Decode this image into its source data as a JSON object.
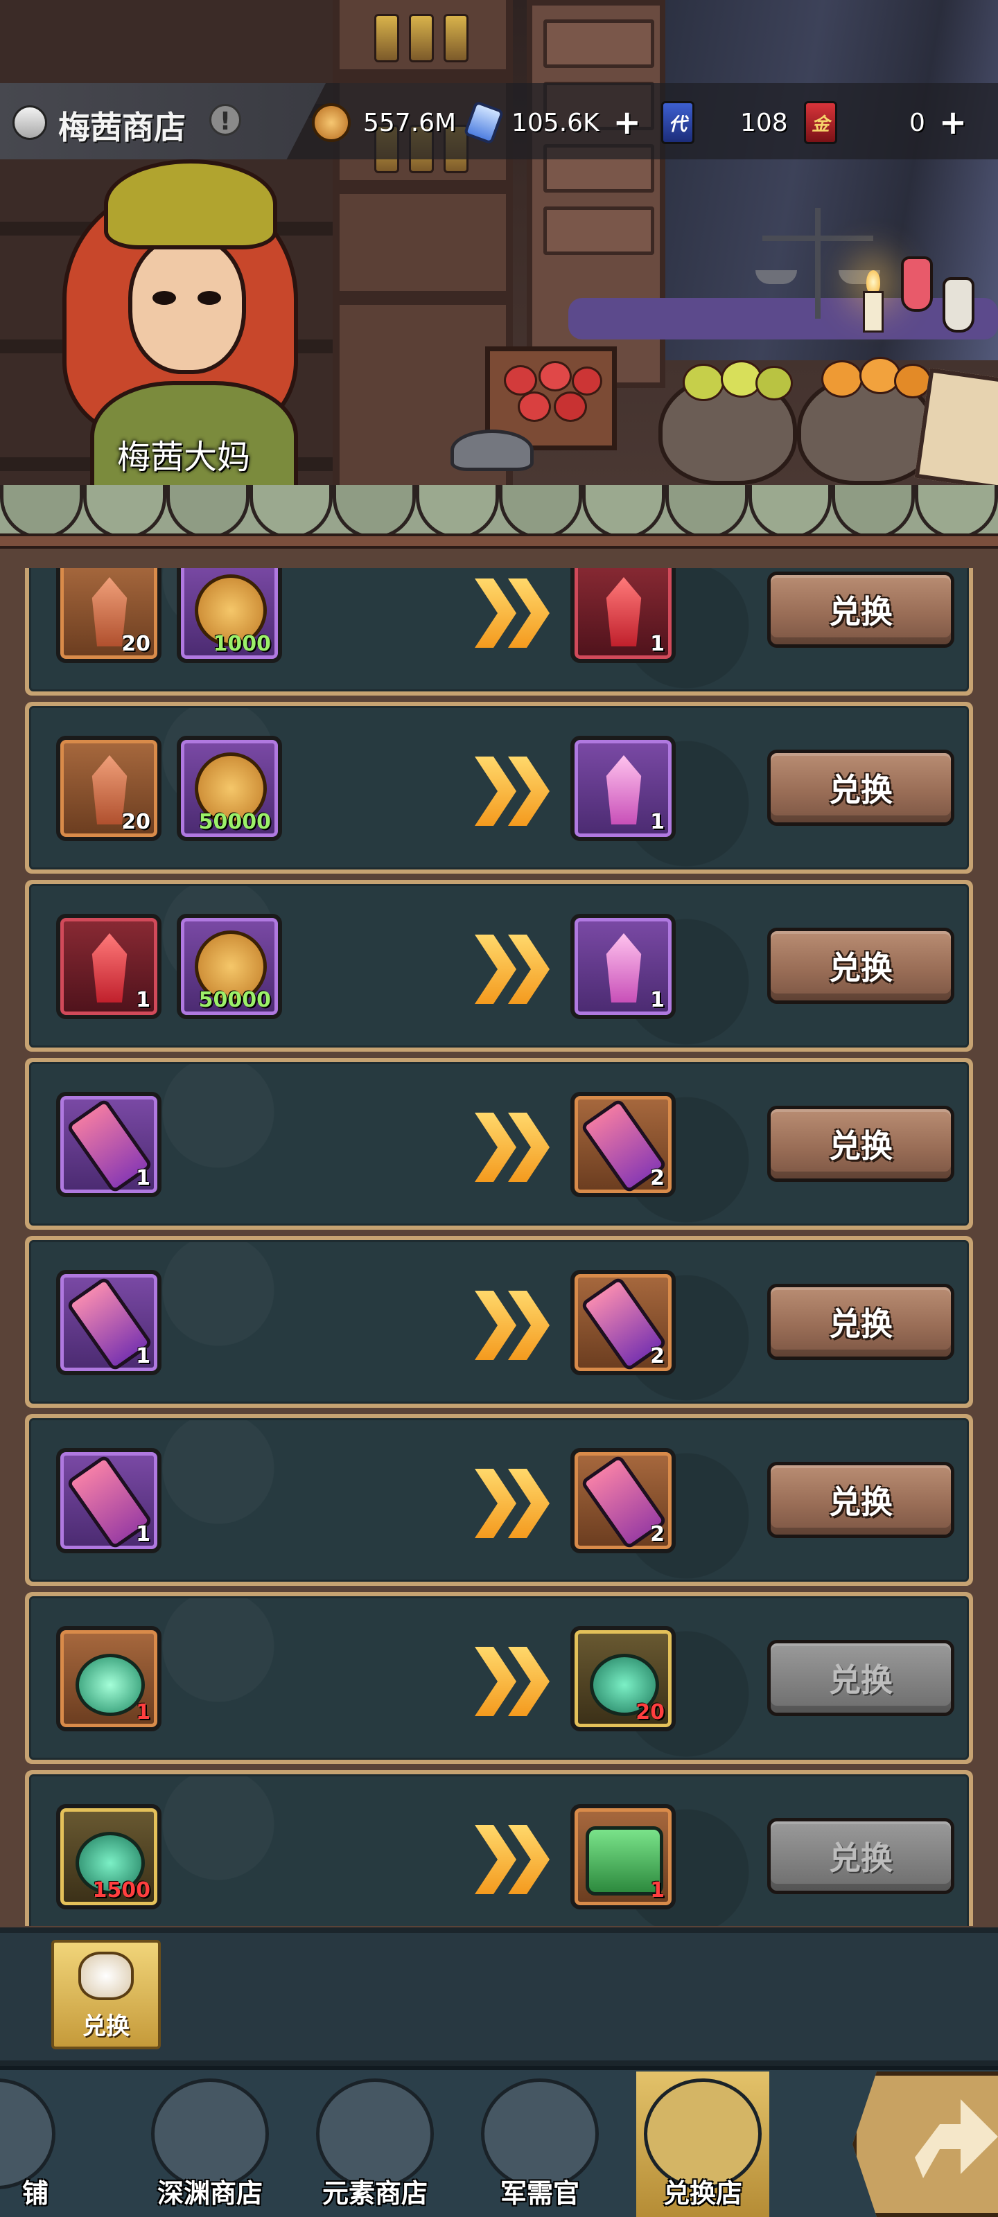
{
  "header": {
    "shop_title": "梅茜商店",
    "info_icon": "info-icon",
    "currencies": [
      {
        "name": "coin",
        "icon": "gold-coin-icon",
        "value": "557.6M"
      },
      {
        "name": "crystal",
        "icon": "blue-crystal-icon",
        "value": "105.6K",
        "add": "+"
      },
      {
        "name": "voucher",
        "icon": "blue-card-icon",
        "value": "108",
        "badge": "代"
      },
      {
        "name": "gold_card",
        "icon": "red-card-icon",
        "value": "0",
        "badge": "金",
        "add": "+"
      }
    ]
  },
  "npc": {
    "name": "梅茜大妈"
  },
  "exchange_label": "兑换",
  "rows": [
    {
      "inputs": [
        {
          "icon": "coral-shard-icon",
          "qty": "20",
          "frame": "orange"
        },
        {
          "icon": "gold-coin-icon",
          "qty": "1000",
          "frame": "purple",
          "qty_color": "green"
        }
      ],
      "output": {
        "icon": "red-crystal-icon",
        "qty": "1",
        "frame": "red"
      },
      "button": "兑换",
      "enabled": true
    },
    {
      "inputs": [
        {
          "icon": "coral-shard-icon",
          "qty": "20",
          "frame": "orange"
        },
        {
          "icon": "gold-coin-icon",
          "qty": "50000",
          "frame": "purple",
          "qty_color": "green"
        }
      ],
      "output": {
        "icon": "pink-crystal-icon",
        "qty": "1",
        "frame": "purple"
      },
      "button": "兑换",
      "enabled": true
    },
    {
      "inputs": [
        {
          "icon": "red-crystal-icon",
          "qty": "1",
          "frame": "red"
        },
        {
          "icon": "gold-coin-icon",
          "qty": "50000",
          "frame": "purple",
          "qty_color": "green"
        }
      ],
      "output": {
        "icon": "pink-crystal-icon",
        "qty": "1",
        "frame": "purple"
      },
      "button": "兑换",
      "enabled": true
    },
    {
      "inputs": [
        {
          "icon": "weapon-scroll-icon",
          "qty": "1",
          "frame": "purple"
        }
      ],
      "output": {
        "icon": "weapon-scroll-icon",
        "qty": "2",
        "frame": "orange"
      },
      "button": "兑换",
      "enabled": true
    },
    {
      "inputs": [
        {
          "icon": "necklace-scroll-icon",
          "qty": "1",
          "frame": "purple"
        }
      ],
      "output": {
        "icon": "necklace-scroll-icon",
        "qty": "2",
        "frame": "orange"
      },
      "button": "兑换",
      "enabled": true
    },
    {
      "inputs": [
        {
          "icon": "armor-scroll-icon",
          "qty": "1",
          "frame": "purple"
        }
      ],
      "output": {
        "icon": "armor-scroll-icon",
        "qty": "2",
        "frame": "orange"
      },
      "button": "兑换",
      "enabled": true
    },
    {
      "inputs": [
        {
          "icon": "sparkle-potion-icon",
          "qty": "1",
          "frame": "orange",
          "qty_color": "red"
        }
      ],
      "output": {
        "icon": "green-potion-icon",
        "qty": "20",
        "frame": "gold",
        "qty_color": "red"
      },
      "button": "兑换",
      "enabled": false
    },
    {
      "inputs": [
        {
          "icon": "green-potion-icon",
          "qty": "1500",
          "frame": "gold",
          "qty_color": "red"
        }
      ],
      "output": {
        "icon": "green-chest-icon",
        "qty": "1",
        "frame": "orange",
        "qty_color": "red"
      },
      "button": "兑换",
      "enabled": false
    }
  ],
  "subtabs": [
    {
      "label": "兑换",
      "icon": "exchange-hands-icon",
      "active": true
    }
  ],
  "nav": [
    {
      "label": "铺",
      "icon": "shop-barrel-icon"
    },
    {
      "label": "深渊商店",
      "icon": "abyss-crate-icon"
    },
    {
      "label": "元素商店",
      "icon": "element-star-icon"
    },
    {
      "label": "军需官",
      "icon": "quartermaster-helmet-icon"
    },
    {
      "label": "兑换店",
      "icon": "exchange-shield-icon",
      "active": true
    }
  ],
  "share_icon": "share-arrow-icon",
  "colors": {
    "button_brown": "#9a6e57",
    "button_disabled": "#7d7d7d",
    "row_border": "#c7a372",
    "row_bg": "#273a40",
    "arrow_gold": "#f7b53a",
    "qty_green": "#9cf06a",
    "qty_red": "#ff3f3f"
  }
}
